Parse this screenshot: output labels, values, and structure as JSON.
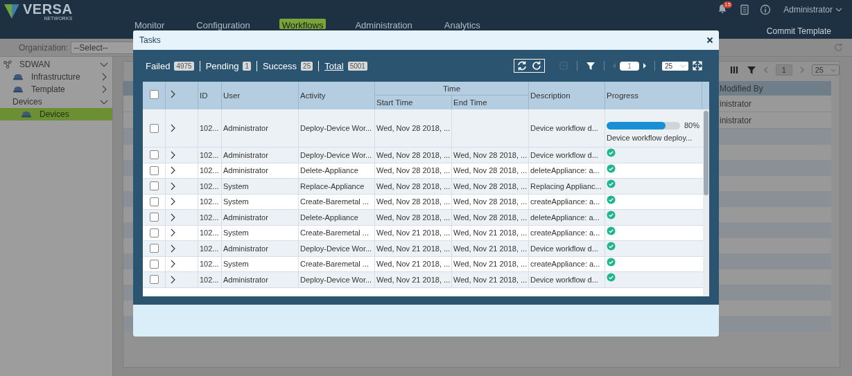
{
  "header": {
    "logo": {
      "name": "VERSA",
      "tagline": "NETWORKS"
    },
    "nav": [
      {
        "label": "Monitor",
        "selected": false
      },
      {
        "label": "Configuration",
        "selected": false
      },
      {
        "label": "Workflows",
        "selected": true
      },
      {
        "label": "Administration",
        "selected": false
      },
      {
        "label": "Analytics",
        "selected": false
      }
    ],
    "notifications": "15",
    "user": "Administrator",
    "commit": "Commit Template"
  },
  "sidebar": {
    "organization": {
      "label": "Organization:",
      "value": "--Select--"
    },
    "items": [
      {
        "label": "SDWAN",
        "expanded": true,
        "selected": false,
        "children": [
          {
            "label": "Infrastructure",
            "expanded": false,
            "selected": false
          },
          {
            "label": "Template",
            "expanded": false,
            "selected": false
          },
          {
            "label": "Devices",
            "expanded": true,
            "selected": false,
            "children": [
              {
                "label": "Devices",
                "selected": true
              }
            ]
          }
        ]
      }
    ]
  },
  "main": {
    "page": "1",
    "page_size": "25",
    "column": "Modified By",
    "rows": [
      "inistrator",
      "inistrator"
    ]
  },
  "dialog": {
    "title": "Tasks",
    "summary": [
      {
        "label": "Failed",
        "count": "4975",
        "link": false
      },
      {
        "label": "Pending",
        "count": "1",
        "link": false
      },
      {
        "label": "Success",
        "count": "25",
        "link": false
      },
      {
        "label": "Total",
        "count": "5001",
        "link": true
      }
    ],
    "page": "1",
    "page_size": "25",
    "select_all": false,
    "columns": {
      "id": "ID",
      "user": "User",
      "activity": "Activity",
      "time": "Time",
      "start_time": "Start Time",
      "end_time": "End Time",
      "description": "Description",
      "progress": "Progress"
    },
    "rows": [
      {
        "checked": false,
        "expanded": false,
        "id": "102...",
        "user": "Administrator",
        "activity": "Deploy-Device Wor...",
        "start_time": "Wed, Nov 28 2018, ...",
        "end_time": "",
        "description": "Device workflow d...",
        "kind": "progress",
        "level": 0.8,
        "percent": "80%",
        "message": "Device workflow deploy..."
      },
      {
        "checked": false,
        "expanded": false,
        "id": "102...",
        "user": "Administrator",
        "activity": "Deploy-Device Wor...",
        "start_time": "Wed, Nov 28 2018, ...",
        "end_time": "Wed, Nov 28 2018, ...",
        "description": "Device workflow d...",
        "kind": "done"
      },
      {
        "checked": false,
        "expanded": false,
        "id": "102...",
        "user": "Administrator",
        "activity": "Delete-Appliance",
        "start_time": "Wed, Nov 28 2018, ...",
        "end_time": "Wed, Nov 28 2018, ...",
        "description": "deleteAppliance: a...",
        "kind": "done"
      },
      {
        "checked": false,
        "expanded": false,
        "id": "102...",
        "user": "System",
        "activity": "Replace-Appliance",
        "start_time": "Wed, Nov 28 2018, ...",
        "end_time": "Wed, Nov 28 2018, ...",
        "description": "Replacing Applianc...",
        "kind": "done"
      },
      {
        "checked": false,
        "expanded": false,
        "id": "102...",
        "user": "System",
        "activity": "Create-Baremetal ...",
        "start_time": "Wed, Nov 28 2018, ...",
        "end_time": "Wed, Nov 28 2018, ...",
        "description": "createAppliance: a...",
        "kind": "done"
      },
      {
        "checked": false,
        "expanded": false,
        "id": "102...",
        "user": "Administrator",
        "activity": "Delete-Appliance",
        "start_time": "Wed, Nov 28 2018, ...",
        "end_time": "Wed, Nov 28 2018, ...",
        "description": "deleteAppliance: a...",
        "kind": "done"
      },
      {
        "checked": false,
        "expanded": false,
        "id": "102...",
        "user": "System",
        "activity": "Create-Baremetal ...",
        "start_time": "Wed, Nov 21 2018, ...",
        "end_time": "Wed, Nov 21 2018, ...",
        "description": "createAppliance: a...",
        "kind": "done"
      },
      {
        "checked": false,
        "expanded": false,
        "id": "102...",
        "user": "Administrator",
        "activity": "Deploy-Device Wor...",
        "start_time": "Wed, Nov 21 2018, ...",
        "end_time": "Wed, Nov 21 2018, ...",
        "description": "Device workflow d...",
        "kind": "done"
      },
      {
        "checked": false,
        "expanded": false,
        "id": "102...",
        "user": "System",
        "activity": "Create-Baremetal ...",
        "start_time": "Wed, Nov 21 2018, ...",
        "end_time": "Wed, Nov 21 2018, ...",
        "description": "createAppliance: a...",
        "kind": "done"
      },
      {
        "checked": false,
        "expanded": false,
        "id": "102...",
        "user": "Administrator",
        "activity": "Deploy-Device Wor...",
        "start_time": "Wed, Nov 21 2018, ...",
        "end_time": "Wed, Nov 21 2018, ...",
        "description": "Device workflow d...",
        "kind": "done"
      }
    ]
  }
}
